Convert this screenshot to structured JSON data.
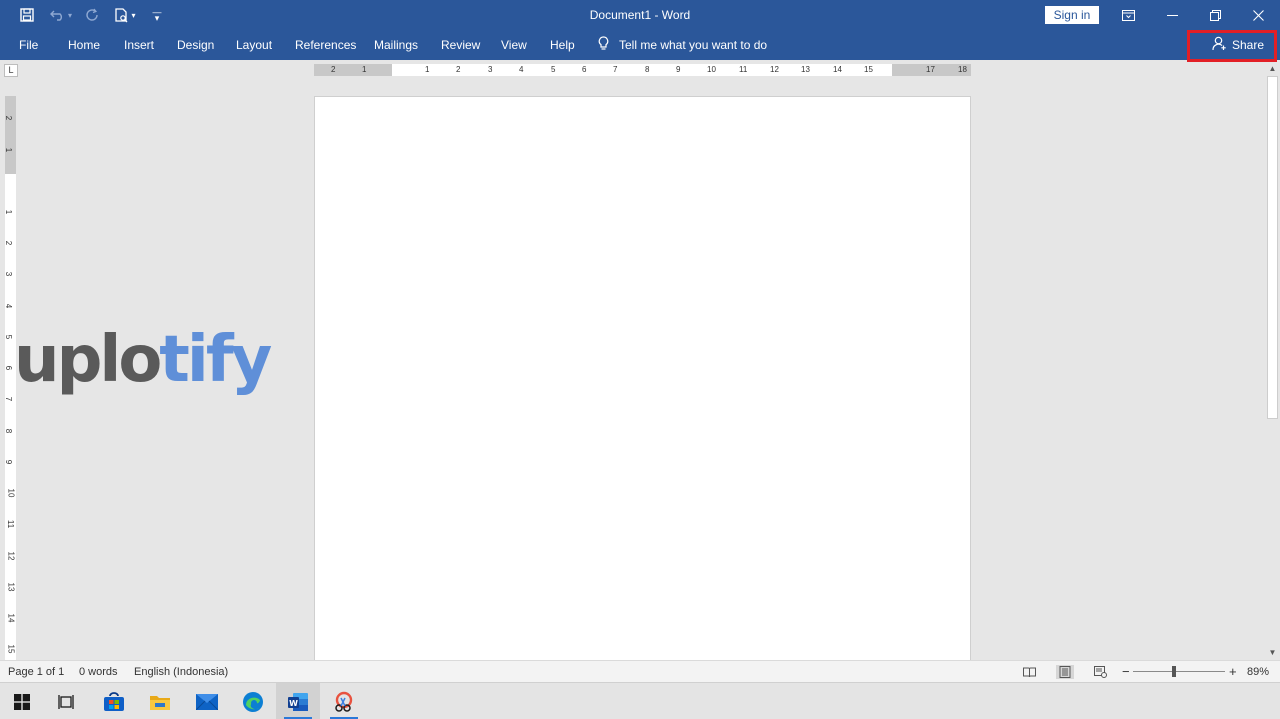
{
  "window": {
    "title": "Document1  -  Word",
    "sign_in": "Sign in"
  },
  "quick_access": {
    "save": "save-icon",
    "undo": "undo-icon",
    "redo": "redo-icon",
    "print_preview": "print-preview-icon",
    "customize": "customize-icon"
  },
  "ribbon": {
    "tabs": [
      "File",
      "Home",
      "Insert",
      "Design",
      "Layout",
      "References",
      "Mailings",
      "Review",
      "View",
      "Help"
    ],
    "tell_me": "Tell me what you want to do",
    "share": "Share"
  },
  "ruler": {
    "horizontal": [
      "2",
      "1",
      "1",
      "2",
      "3",
      "4",
      "5",
      "6",
      "7",
      "8",
      "9",
      "10",
      "11",
      "12",
      "13",
      "14",
      "15",
      "17",
      "18"
    ],
    "vertical": [
      "2",
      "1",
      "1",
      "2",
      "3",
      "4",
      "5",
      "6",
      "7",
      "8",
      "9",
      "10",
      "11",
      "12",
      "13",
      "14",
      "15"
    ]
  },
  "watermark": {
    "part1": "uplo",
    "part2": "tify"
  },
  "status": {
    "page": "Page 1 of 1",
    "words": "0 words",
    "language": "English (Indonesia)",
    "zoom": "89%",
    "zoom_minus": "−",
    "zoom_plus": "+"
  },
  "colors": {
    "accent": "#2b579a",
    "highlight": "#e21f26",
    "watermark_gray": "#5a5a5a",
    "watermark_blue": "#5f8fd8"
  }
}
